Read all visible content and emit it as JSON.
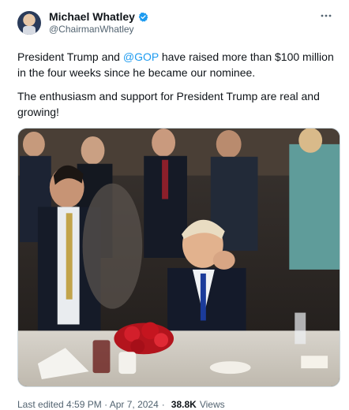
{
  "author": {
    "display_name": "Michael Whatley",
    "handle": "@ChairmanWhatley",
    "verified_color": "#1d9bf0"
  },
  "tweet": {
    "paragraph1": {
      "prefix": "President Trump and ",
      "mention": "@GOP",
      "suffix": " have raised more than $100 million in the four weeks since he became our nominee."
    },
    "paragraph2": "The enthusiasm and support for President Trump are real and growing!"
  },
  "meta": {
    "last_edited": "Last edited 4:59 PM · Apr 7, 2024",
    "separator": "·",
    "views_count": "38.8K",
    "views_label": "Views"
  },
  "icons": {
    "more": "more-options-icon",
    "verified": "verified-badge-icon"
  },
  "colors": {
    "link": "#1d9bf0",
    "secondary_text": "#536471",
    "border": "#cfd9de"
  }
}
